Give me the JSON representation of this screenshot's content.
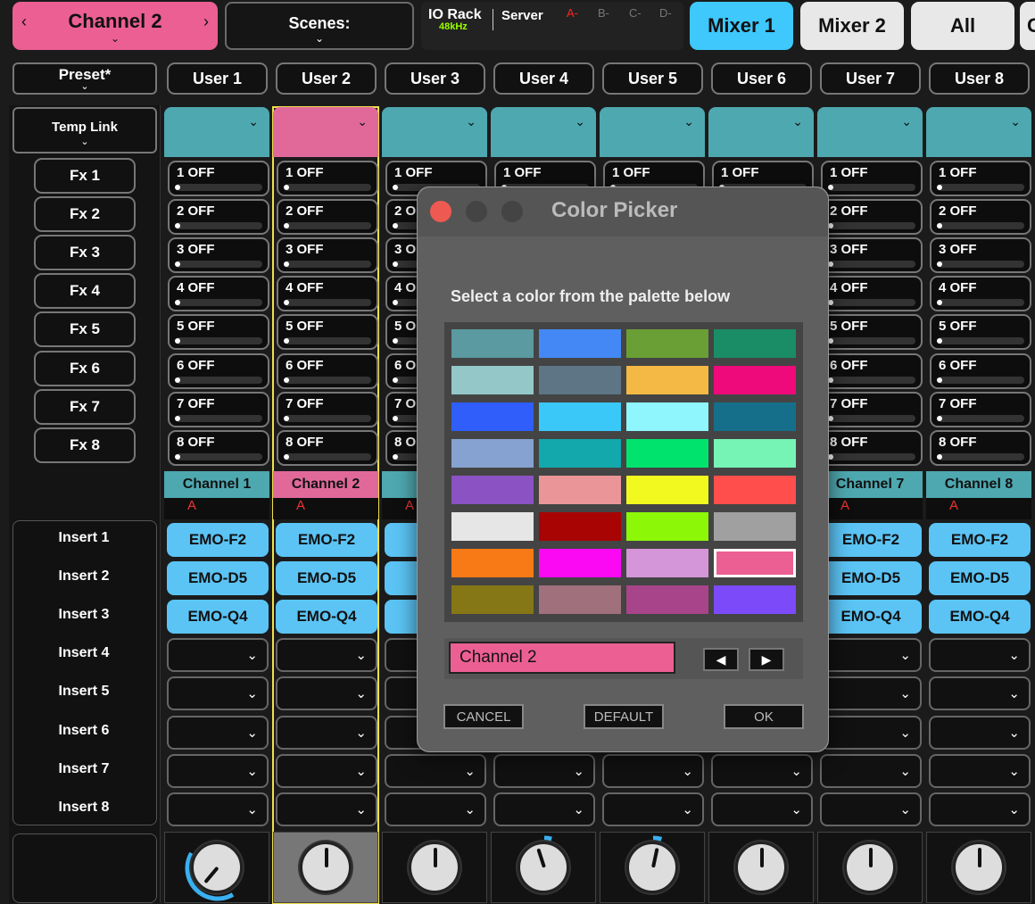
{
  "top": {
    "channel_select": "Channel 2",
    "scenes_label": "Scenes:",
    "io_rack": "IO Rack",
    "sample_rate": "48kHz",
    "server": "Server",
    "ports": [
      "A-",
      "B-",
      "C-",
      "D-"
    ],
    "tabs": [
      "Mixer 1",
      "Mixer 2",
      "All",
      "C"
    ],
    "accent_active": "#3ec8fb",
    "channel_color": "#ec5f92"
  },
  "left": {
    "preset": "Preset*",
    "temp_link": "Temp Link",
    "fx": [
      "Fx 1",
      "Fx 2",
      "Fx 3",
      "Fx 4",
      "Fx 5",
      "Fx 6",
      "Fx 7",
      "Fx 8"
    ],
    "inserts": [
      "Insert 1",
      "Insert 2",
      "Insert 3",
      "Insert 4",
      "Insert 5",
      "Insert 6",
      "Insert 7",
      "Insert 8"
    ]
  },
  "users": [
    "User 1",
    "User 2",
    "User 3",
    "User 4",
    "User 5",
    "User 6",
    "User 7",
    "User 8"
  ],
  "sends": [
    "1 OFF",
    "2 OFF",
    "3 OFF",
    "4 OFF",
    "5 OFF",
    "6 OFF",
    "7 OFF",
    "8 OFF"
  ],
  "channels": [
    {
      "name": "Channel 1",
      "color": "#4ea8b0",
      "port": "A",
      "inserts": [
        "EMO-F2",
        "EMO-D5",
        "EMO-Q4"
      ],
      "selected": false
    },
    {
      "name": "Channel 2",
      "color": "#e0699a",
      "port": "A",
      "inserts": [
        "EMO-F2",
        "EMO-D5",
        "EMO-Q4"
      ],
      "selected": true
    },
    {
      "name": "Ch",
      "color": "#4ea8b0",
      "port": "A",
      "inserts": [
        "EI",
        "EI",
        "EI"
      ],
      "selected": false
    },
    {
      "name": "",
      "color": "#4ea8b0",
      "port": "",
      "inserts": [],
      "selected": false
    },
    {
      "name": "",
      "color": "#4ea8b0",
      "port": "",
      "inserts": [],
      "selected": false
    },
    {
      "name": "",
      "color": "#4ea8b0",
      "port": "",
      "inserts": [],
      "selected": false
    },
    {
      "name": "Channel 7",
      "color": "#4ea8b0",
      "port": "A",
      "inserts": [
        "EMO-F2",
        "EMO-D5",
        "EMO-Q4"
      ],
      "selected": false
    },
    {
      "name": "Channel 8",
      "color": "#4ea8b0",
      "port": "A",
      "inserts": [
        "EMO-F2",
        "EMO-D5",
        "EMO-Q4"
      ],
      "selected": false
    }
  ],
  "dialog": {
    "title": "Color Picker",
    "instruction": "Select a color from the palette below",
    "name_value": "Channel 2",
    "prev_label": "◀",
    "next_label": "▶",
    "cancel": "CANCEL",
    "default": "DEFAULT",
    "ok": "OK",
    "selected_index": 27,
    "palette": [
      "#5a9aa0",
      "#4488f5",
      "#6a9f36",
      "#1a8c66",
      "#94c8c8",
      "#5d7585",
      "#f4b944",
      "#ee0a7a",
      "#2f5efa",
      "#3ac8f8",
      "#8ef6fc",
      "#166f8a",
      "#86a2d0",
      "#12a8ac",
      "#00e46e",
      "#76f4b6",
      "#8b52c4",
      "#ea9698",
      "#f2f91e",
      "#ff4e4c",
      "#e6e6e6",
      "#a80404",
      "#8cf808",
      "#a0a0a0",
      "#f77a16",
      "#fb09f3",
      "#d496d8",
      "#ec5f92",
      "#857716",
      "#a0707c",
      "#a8448a",
      "#7c4af8"
    ]
  }
}
